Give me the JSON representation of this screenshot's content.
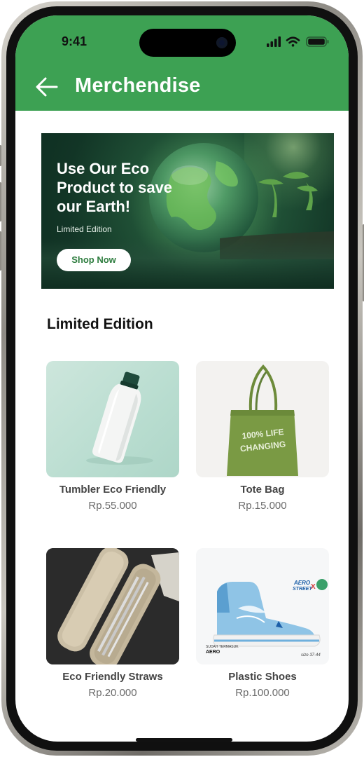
{
  "status_bar": {
    "time": "9:41"
  },
  "header": {
    "title": "Merchendise"
  },
  "banner": {
    "headline": "Use Our Eco Product to save our Earth!",
    "subtitle": "Limited Edition",
    "cta_label": "Shop Now"
  },
  "section": {
    "title": "Limited Edition"
  },
  "products": [
    {
      "name": "Tumbler Eco Friendly",
      "price": "Rp.55.000",
      "image_icon": "tumbler-image"
    },
    {
      "name": "Tote Bag",
      "price": "Rp.15.000",
      "image_icon": "tote-bag-image",
      "print_text": "100% LIFE CHANGING"
    },
    {
      "name": "Eco Friendly Straws",
      "price": "Rp.20.000",
      "image_icon": "straws-image"
    },
    {
      "name": "Plastic Shoes",
      "price": "Rp.100.000",
      "image_icon": "shoes-image",
      "brand_text": "AERO STREET",
      "tag_text": "SUDAH TERMASUK AERO",
      "size_text": "size 37-44"
    }
  ],
  "colors": {
    "brand_green": "#3da153",
    "button_text_green": "#2e7d3f"
  }
}
